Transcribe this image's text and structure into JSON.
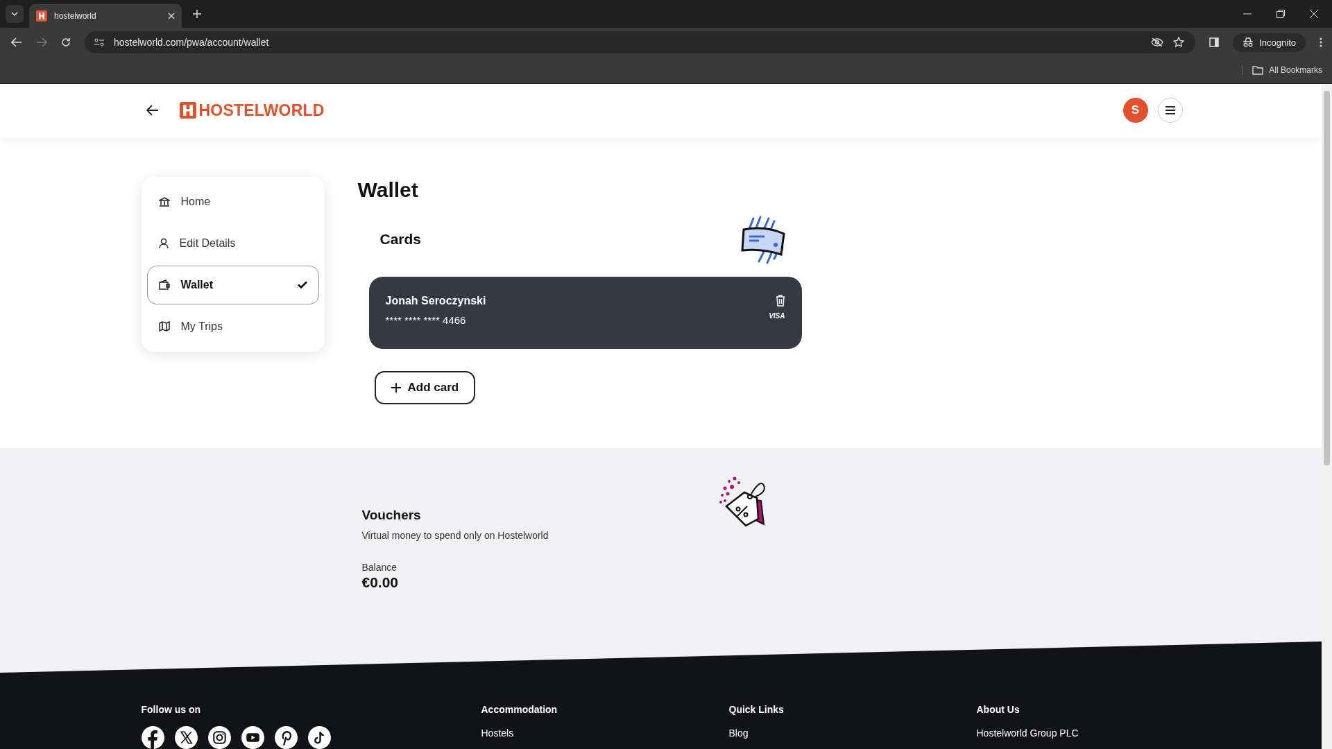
{
  "browser": {
    "tab_title": "hostelworld",
    "url": "hostelworld.com/pwa/account/wallet",
    "profile_label": "Incognito",
    "bookmarks_label": "All Bookmarks"
  },
  "header": {
    "logo_text": "HOSTELWORLD",
    "avatar_initial": "S"
  },
  "sidebar": {
    "items": [
      {
        "label": "Home",
        "kind": "home",
        "selected": false
      },
      {
        "label": "Edit Details",
        "kind": "person",
        "selected": false
      },
      {
        "label": "Wallet",
        "kind": "wallet",
        "selected": true
      },
      {
        "label": "My Trips",
        "kind": "map",
        "selected": false
      }
    ]
  },
  "page_title": "Wallet",
  "cards": {
    "title": "Cards",
    "items": [
      {
        "holder": "Jonah Seroczynski",
        "number": "**** **** **** 4466",
        "brand": "VISA"
      }
    ],
    "add_button": "Add card"
  },
  "vouchers": {
    "title": "Vouchers",
    "description": "Virtual money to spend only on Hostelworld",
    "balance_label": "Balance",
    "balance": "€0.00"
  },
  "footer": {
    "follow_label": "Follow us on",
    "columns": [
      {
        "heading": "Accommodation",
        "links": [
          "Hostels"
        ]
      },
      {
        "heading": "Quick Links",
        "links": [
          "Blog"
        ]
      },
      {
        "heading": "About Us",
        "links": [
          "Hostelworld Group PLC"
        ]
      }
    ]
  }
}
